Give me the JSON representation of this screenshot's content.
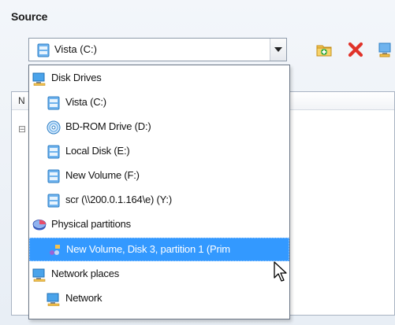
{
  "section": {
    "title": "Source"
  },
  "combo": {
    "selected_value": "Vista (C:)",
    "selected_icon": "drive-icon"
  },
  "toolbar": {
    "icons": [
      "add-folder-icon",
      "delete-icon",
      "network-icon"
    ]
  },
  "background_panel": {
    "header_text": "N",
    "tree_expander": "⊟"
  },
  "dropdown": {
    "items": [
      {
        "label": "Disk Drives",
        "icon": "computer-icon",
        "level": 0
      },
      {
        "label": "Vista (C:)",
        "icon": "drive-icon",
        "level": 1
      },
      {
        "label": "BD-ROM Drive (D:)",
        "icon": "optical-drive-icon",
        "level": 1
      },
      {
        "label": "Local Disk (E:)",
        "icon": "drive-icon",
        "level": 1
      },
      {
        "label": "New Volume (F:)",
        "icon": "drive-icon",
        "level": 1
      },
      {
        "label": "scr (\\\\200.0.1.164\\e) (Y:)",
        "icon": "network-drive-icon",
        "level": 1
      },
      {
        "label": "Physical partitions",
        "icon": "partition-disk-icon",
        "level": 0
      },
      {
        "label": "New Volume, Disk 3, partition 1 (Prim",
        "icon": "partition-icon",
        "level": 1,
        "selected": true
      },
      {
        "label": "Network places",
        "icon": "computer-icon",
        "level": 0
      },
      {
        "label": "Network",
        "icon": "computer-icon",
        "level": 1
      }
    ]
  },
  "colors": {
    "selection": "#3399ff",
    "drive_blue": "#5aa6e6"
  }
}
